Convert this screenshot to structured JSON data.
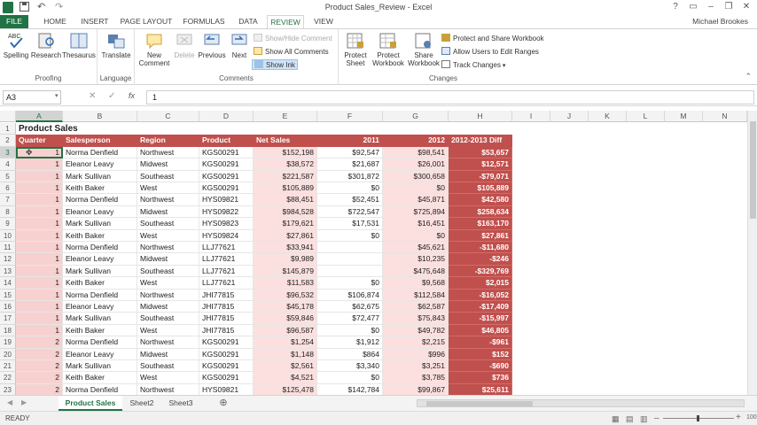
{
  "window": {
    "title": "Product Sales_Review - Excel",
    "user": "Michael Brookes"
  },
  "tabs": [
    "FILE",
    "HOME",
    "INSERT",
    "PAGE LAYOUT",
    "FORMULAS",
    "DATA",
    "REVIEW",
    "VIEW"
  ],
  "active_tab": "REVIEW",
  "ribbon": {
    "proofing": {
      "label": "Proofing",
      "spelling": "Spelling",
      "spelling_icon_text": "ABC",
      "research": "Research",
      "thesaurus": "Thesaurus"
    },
    "language": {
      "label": "Language",
      "translate": "Translate"
    },
    "comments": {
      "label": "Comments",
      "new_comment_1": "New",
      "new_comment_2": "Comment",
      "delete": "Delete",
      "previous": "Previous",
      "next": "Next",
      "show_hide": "Show/Hide Comment",
      "show_all": "Show All Comments",
      "show_ink": "Show Ink"
    },
    "changes": {
      "label": "Changes",
      "protect_sheet_1": "Protect",
      "protect_sheet_2": "Sheet",
      "protect_workbook_1": "Protect",
      "protect_workbook_2": "Workbook",
      "share_workbook_1": "Share",
      "share_workbook_2": "Workbook",
      "protect_share": "Protect and Share Workbook",
      "allow_users": "Allow Users to Edit Ranges",
      "track_changes": "Track Changes"
    }
  },
  "formula_bar": {
    "name_box": "A3",
    "fx": "fx",
    "value": "1"
  },
  "columns": [
    "A",
    "B",
    "C",
    "D",
    "E",
    "F",
    "G",
    "H",
    "I",
    "J",
    "K",
    "L",
    "M",
    "N"
  ],
  "sheet_title": "Product Sales",
  "headers": [
    "Quarter",
    "Salesperson",
    "Region",
    "Product",
    "Net Sales",
    "2011",
    "2012",
    "2012-2013 Diff"
  ],
  "rows": [
    [
      "1",
      "Norma Denfield",
      "Northwest",
      "KGS00291",
      "$152,198",
      "$92,547",
      "$98,541",
      "$53,657"
    ],
    [
      "1",
      "Eleanor Leavy",
      "Midwest",
      "KGS00291",
      "$38,572",
      "$21,687",
      "$26,001",
      "$12,571"
    ],
    [
      "1",
      "Mark Sullivan",
      "Southeast",
      "KGS00291",
      "$221,587",
      "$301,872",
      "$300,658",
      "-$79,071"
    ],
    [
      "1",
      "Keith Baker",
      "West",
      "KGS00291",
      "$105,889",
      "$0",
      "$0",
      "$105,889"
    ],
    [
      "1",
      "Norma Denfield",
      "Northwest",
      "HYS09821",
      "$88,451",
      "$52,451",
      "$45,871",
      "$42,580"
    ],
    [
      "1",
      "Eleanor Leavy",
      "Midwest",
      "HYS09822",
      "$984,528",
      "$722,547",
      "$725,894",
      "$258,634"
    ],
    [
      "1",
      "Mark Sullivan",
      "Southeast",
      "HYS09823",
      "$179,621",
      "$17,531",
      "$16,451",
      "$163,170"
    ],
    [
      "1",
      "Keith Baker",
      "West",
      "HYS09824",
      "$27,861",
      "$0",
      "$0",
      "$27,861"
    ],
    [
      "1",
      "Norma Denfield",
      "Northwest",
      "LLJ77621",
      "$33,941",
      "",
      "$45,621",
      "-$11,680"
    ],
    [
      "1",
      "Eleanor Leavy",
      "Midwest",
      "LLJ77621",
      "$9,989",
      "",
      "$10,235",
      "-$246"
    ],
    [
      "1",
      "Mark Sullivan",
      "Southeast",
      "LLJ77621",
      "$145,879",
      "",
      "$475,648",
      "-$329,769"
    ],
    [
      "1",
      "Keith Baker",
      "West",
      "LLJ77621",
      "$11,583",
      "$0",
      "$9,568",
      "$2,015"
    ],
    [
      "1",
      "Norma Denfield",
      "Northwest",
      "JHI77815",
      "$96,532",
      "$106,874",
      "$112,584",
      "-$16,052"
    ],
    [
      "1",
      "Eleanor Leavy",
      "Midwest",
      "JHI77815",
      "$45,178",
      "$62,675",
      "$62,587",
      "-$17,409"
    ],
    [
      "1",
      "Mark Sullivan",
      "Southeast",
      "JHI77815",
      "$59,846",
      "$72,477",
      "$75,843",
      "-$15,997"
    ],
    [
      "1",
      "Keith Baker",
      "West",
      "JHI77815",
      "$96,587",
      "$0",
      "$49,782",
      "$46,805"
    ],
    [
      "2",
      "Norma Denfield",
      "Northwest",
      "KGS00291",
      "$1,254",
      "$1,912",
      "$2,215",
      "-$961"
    ],
    [
      "2",
      "Eleanor Leavy",
      "Midwest",
      "KGS00291",
      "$1,148",
      "$864",
      "$996",
      "$152"
    ],
    [
      "2",
      "Mark Sullivan",
      "Southeast",
      "KGS00291",
      "$2,561",
      "$3,340",
      "$3,251",
      "-$690"
    ],
    [
      "2",
      "Keith Baker",
      "West",
      "KGS00291",
      "$4,521",
      "$0",
      "$3,785",
      "$736"
    ],
    [
      "2",
      "Norma Denfield",
      "Northwest",
      "HYS09821",
      "$125,478",
      "$142,784",
      "$99,867",
      "$25,611"
    ]
  ],
  "sheets": [
    "Product Sales",
    "Sheet2",
    "Sheet3"
  ],
  "active_sheet": "Product Sales",
  "status": {
    "mode": "READY",
    "zoom": "100%"
  }
}
